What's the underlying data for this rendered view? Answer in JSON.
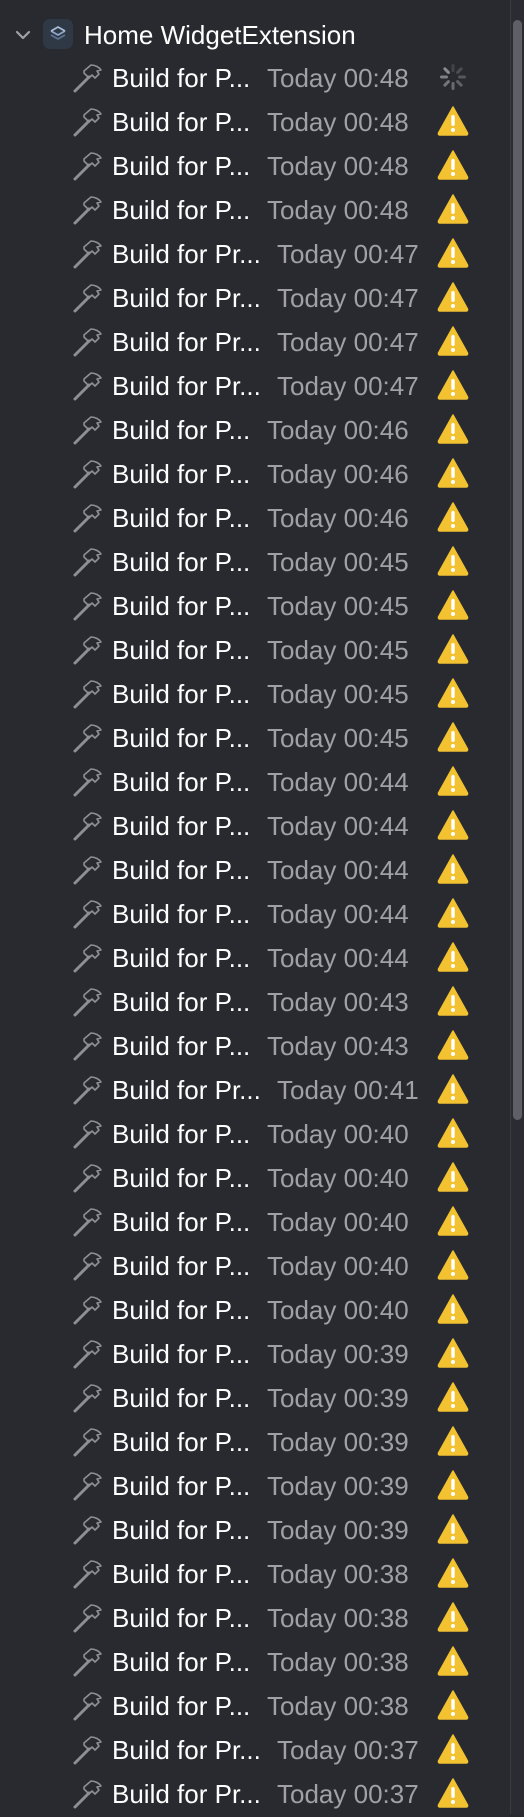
{
  "header": {
    "title": "Home WidgetExtension",
    "expand_icon": "chevron-down-icon",
    "target_icon": "widget-extension-icon"
  },
  "colors": {
    "background": "#292a2f",
    "text_primary": "#ffffff",
    "text_secondary": "#a0a0a5",
    "warning": "#f2c230",
    "spinner": "#8e8e93"
  },
  "rows": [
    {
      "name": "Build for P...",
      "time": "Today 00:48",
      "status": "in-progress"
    },
    {
      "name": "Build for P...",
      "time": "Today 00:48",
      "status": "warning"
    },
    {
      "name": "Build for P...",
      "time": "Today 00:48",
      "status": "warning"
    },
    {
      "name": "Build for P...",
      "time": "Today 00:48",
      "status": "warning"
    },
    {
      "name": "Build for Pr...",
      "time": "Today 00:47",
      "status": "warning"
    },
    {
      "name": "Build for Pr...",
      "time": "Today 00:47",
      "status": "warning"
    },
    {
      "name": "Build for Pr...",
      "time": "Today 00:47",
      "status": "warning"
    },
    {
      "name": "Build for Pr...",
      "time": "Today 00:47",
      "status": "warning"
    },
    {
      "name": "Build for P...",
      "time": "Today 00:46",
      "status": "warning"
    },
    {
      "name": "Build for P...",
      "time": "Today 00:46",
      "status": "warning"
    },
    {
      "name": "Build for P...",
      "time": "Today 00:46",
      "status": "warning"
    },
    {
      "name": "Build for P...",
      "time": "Today 00:45",
      "status": "warning"
    },
    {
      "name": "Build for P...",
      "time": "Today 00:45",
      "status": "warning"
    },
    {
      "name": "Build for P...",
      "time": "Today 00:45",
      "status": "warning"
    },
    {
      "name": "Build for P...",
      "time": "Today 00:45",
      "status": "warning"
    },
    {
      "name": "Build for P...",
      "time": "Today 00:45",
      "status": "warning"
    },
    {
      "name": "Build for P...",
      "time": "Today 00:44",
      "status": "warning"
    },
    {
      "name": "Build for P...",
      "time": "Today 00:44",
      "status": "warning"
    },
    {
      "name": "Build for P...",
      "time": "Today 00:44",
      "status": "warning"
    },
    {
      "name": "Build for P...",
      "time": "Today 00:44",
      "status": "warning"
    },
    {
      "name": "Build for P...",
      "time": "Today 00:44",
      "status": "warning"
    },
    {
      "name": "Build for P...",
      "time": "Today 00:43",
      "status": "warning"
    },
    {
      "name": "Build for P...",
      "time": "Today 00:43",
      "status": "warning"
    },
    {
      "name": "Build for Pr...",
      "time": "Today 00:41",
      "status": "warning"
    },
    {
      "name": "Build for P...",
      "time": "Today 00:40",
      "status": "warning"
    },
    {
      "name": "Build for P...",
      "time": "Today 00:40",
      "status": "warning"
    },
    {
      "name": "Build for P...",
      "time": "Today 00:40",
      "status": "warning"
    },
    {
      "name": "Build for P...",
      "time": "Today 00:40",
      "status": "warning"
    },
    {
      "name": "Build for P...",
      "time": "Today 00:40",
      "status": "warning"
    },
    {
      "name": "Build for P...",
      "time": "Today 00:39",
      "status": "warning"
    },
    {
      "name": "Build for P...",
      "time": "Today 00:39",
      "status": "warning"
    },
    {
      "name": "Build for P...",
      "time": "Today 00:39",
      "status": "warning"
    },
    {
      "name": "Build for P...",
      "time": "Today 00:39",
      "status": "warning"
    },
    {
      "name": "Build for P...",
      "time": "Today 00:39",
      "status": "warning"
    },
    {
      "name": "Build for P...",
      "time": "Today 00:38",
      "status": "warning"
    },
    {
      "name": "Build for P...",
      "time": "Today 00:38",
      "status": "warning"
    },
    {
      "name": "Build for P...",
      "time": "Today 00:38",
      "status": "warning"
    },
    {
      "name": "Build for P...",
      "time": "Today 00:38",
      "status": "warning"
    },
    {
      "name": "Build for Pr...",
      "time": "Today 00:37",
      "status": "warning"
    },
    {
      "name": "Build for Pr...",
      "time": "Today 00:37",
      "status": "warning"
    }
  ]
}
